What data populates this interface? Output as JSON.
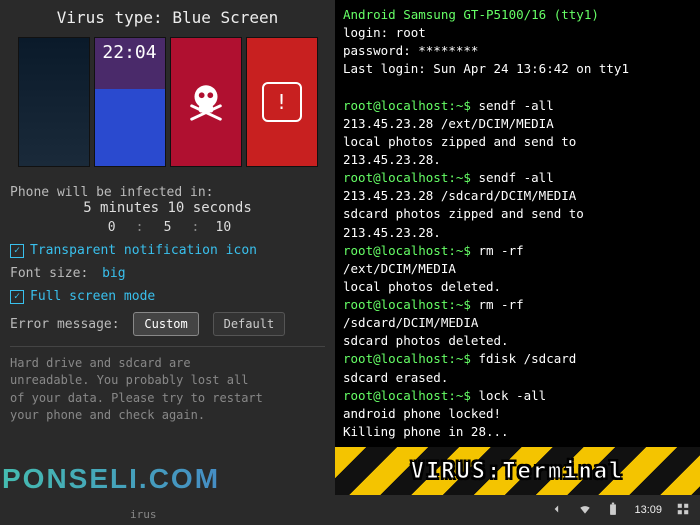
{
  "left": {
    "title": "Virus type: Blue Screen",
    "thumb2_clock": "22:04",
    "countdown_label": "Phone will be infected in:",
    "countdown_text": "5 minutes 10 seconds",
    "spinner": {
      "h": "0",
      "m": "5",
      "s": "10"
    },
    "transparent_icon_label": "Transparent notification icon",
    "font_size_label": "Font size:",
    "font_size_value": "big",
    "full_screen_label": "Full screen mode",
    "error_msg_label": "Error message:",
    "btn_custom": "Custom",
    "btn_default": "Default",
    "error_text": "Hard drive and sdcard are\nunreadable. You probably lost all\nof your data. Please try to restart\nyour phone and check again.",
    "bottom_btn": "irus"
  },
  "terminal": {
    "header": "Android Samsung GT-P5100/16 (tty1)",
    "login_line": "login: root",
    "password_line": "password: ********",
    "lastlogin_line": "Last login: Sun Apr 24 13:6:42 on tty1",
    "prompt": "root@localhost:~$",
    "blocks": [
      {
        "cmd": " sendf -all\n213.45.23.28 /ext/DCIM/MEDIA",
        "out": "local photos zipped and send to\n213.45.23.28."
      },
      {
        "cmd": " sendf -all\n213.45.23.28 /sdcard/DCIM/MEDIA",
        "out": "sdcard photos zipped and send to\n213.45.23.28."
      },
      {
        "cmd": " rm -rf\n/ext/DCIM/MEDIA",
        "out": "local photos deleted."
      },
      {
        "cmd": " rm -rf\n/sdcard/DCIM/MEDIA",
        "out": "sdcard photos deleted."
      },
      {
        "cmd": " fdisk /sdcard",
        "out": "sdcard erased."
      },
      {
        "cmd": " lock -all",
        "out": "android phone locked!\nKilling phone in 28..."
      }
    ]
  },
  "hazard_label": "VIRUS:Terminal",
  "statusbar": {
    "time": "13:09"
  },
  "watermark": "PONSELI.COM"
}
